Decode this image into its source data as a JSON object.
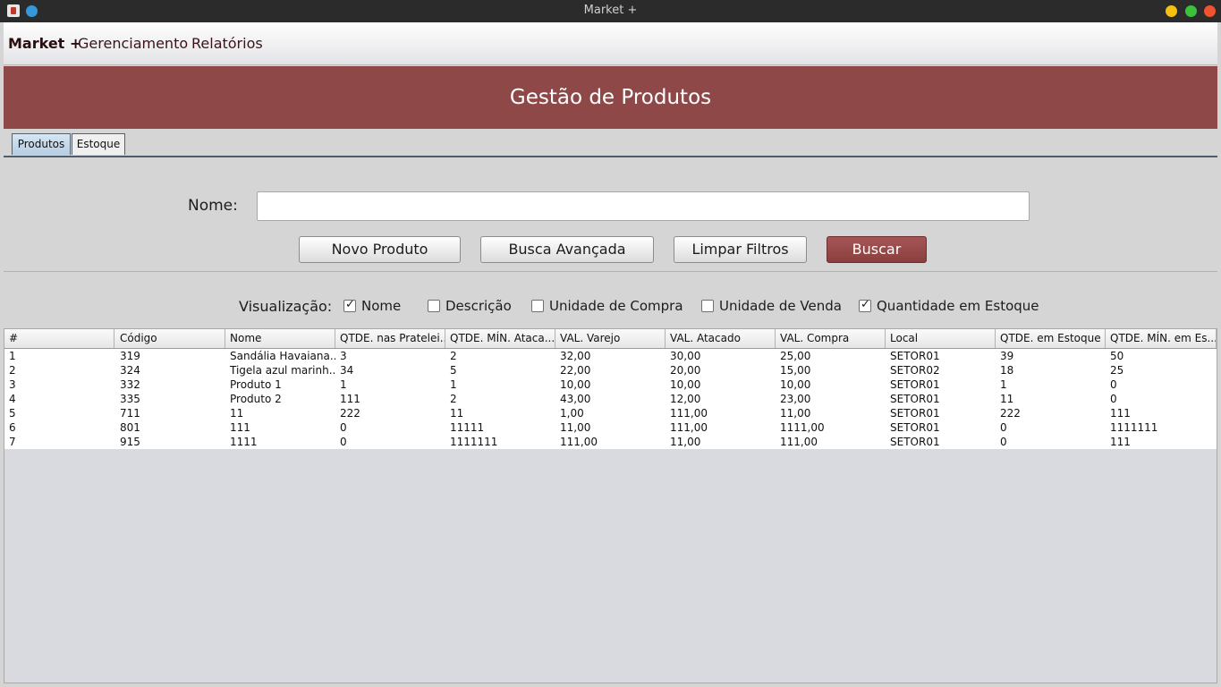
{
  "window": {
    "title": "Market +"
  },
  "menu": {
    "brand": "Market +",
    "items": [
      "Gerenciamento",
      "Relatórios"
    ]
  },
  "banner": {
    "title": "Gestão de Produtos"
  },
  "tabs": [
    {
      "label": "Produtos",
      "active": true
    },
    {
      "label": "Estoque",
      "active": false
    }
  ],
  "search": {
    "label": "Nome:",
    "value": "",
    "buttons": {
      "novo": "Novo Produto",
      "avancada": "Busca Avançada",
      "limpar": "Limpar Filtros",
      "buscar": "Buscar"
    }
  },
  "visualization": {
    "label": "Visualização:",
    "options": [
      {
        "label": "Nome",
        "checked": true
      },
      {
        "label": "Descrição",
        "checked": false
      },
      {
        "label": "Unidade de Compra",
        "checked": false
      },
      {
        "label": "Unidade de Venda",
        "checked": false
      },
      {
        "label": "Quantidade em Estoque",
        "checked": true
      }
    ]
  },
  "table": {
    "columns": [
      "#",
      "Código",
      "Nome",
      "QTDE. nas Pratelei...",
      "QTDE. MÍN. Ataca...",
      "VAL. Varejo",
      "VAL. Atacado",
      "VAL. Compra",
      "Local",
      "QTDE. em Estoque",
      "QTDE. MÍN. em Es..."
    ],
    "rows": [
      [
        "1",
        "319",
        "Sandália Havaiana...",
        "3",
        "2",
        "32,00",
        "30,00",
        "25,00",
        "SETOR01",
        "39",
        "50"
      ],
      [
        "2",
        "324",
        "Tigela azul marinh...",
        "34",
        "5",
        "22,00",
        "20,00",
        "15,00",
        "SETOR02",
        "18",
        "25"
      ],
      [
        "3",
        "332",
        "Produto 1",
        "1",
        "1",
        "10,00",
        "10,00",
        "10,00",
        "SETOR01",
        "1",
        "0"
      ],
      [
        "4",
        "335",
        "Produto 2",
        "111",
        "2",
        "43,00",
        "12,00",
        "23,00",
        "SETOR01",
        "11",
        "0"
      ],
      [
        "5",
        "711",
        "11",
        "222",
        "11",
        "1,00",
        "111,00",
        "11,00",
        "SETOR01",
        "222",
        "111"
      ],
      [
        "6",
        "801",
        "111",
        "0",
        "11111",
        "11,00",
        "111,00",
        "1111,00",
        "SETOR01",
        "0",
        "1111111"
      ],
      [
        "7",
        "915",
        "1111",
        "0",
        "1111111",
        "111,00",
        "11,00",
        "111,00",
        "SETOR01",
        "0",
        "111"
      ]
    ]
  }
}
